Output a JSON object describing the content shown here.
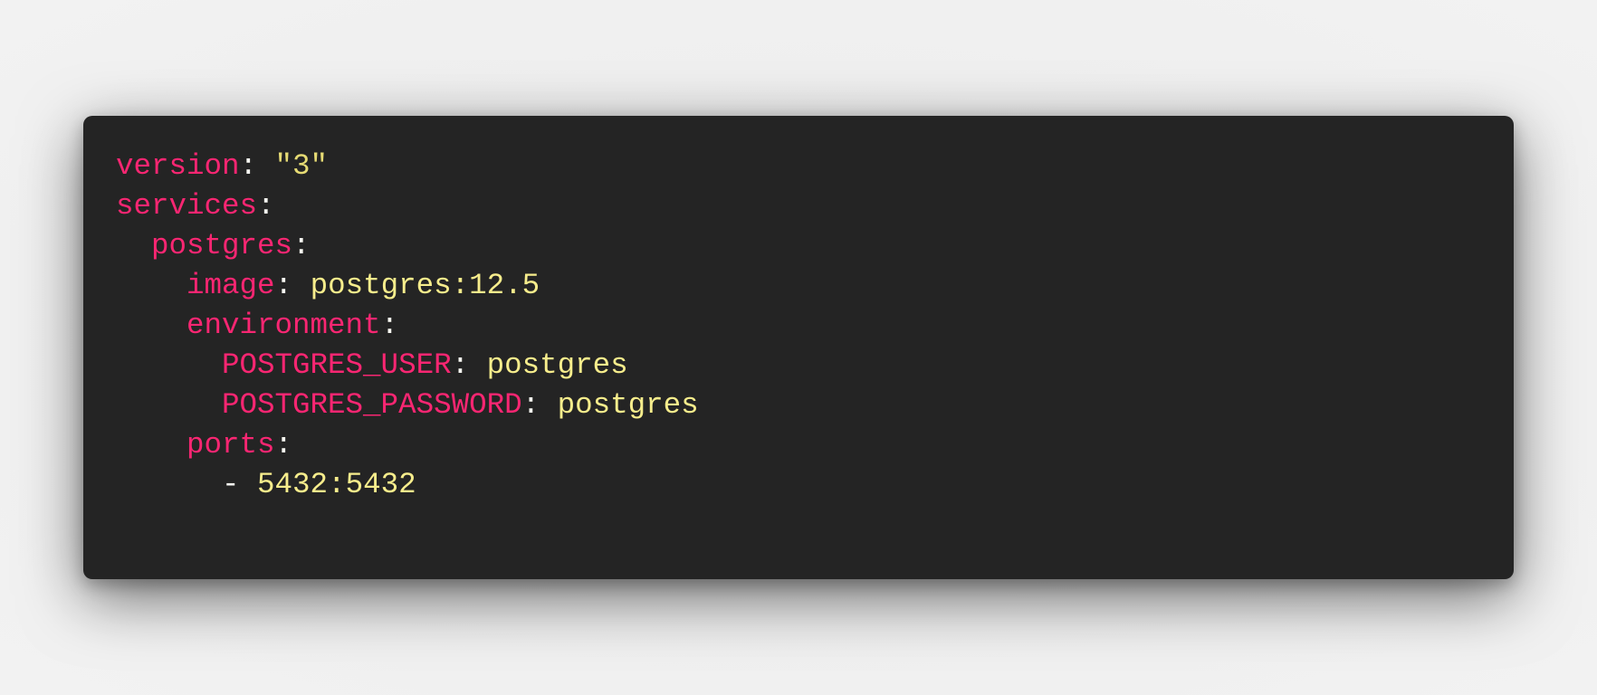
{
  "theme": {
    "key_color": "#f92672",
    "value_color": "#e6db74",
    "punct_color": "#f8f8f2",
    "background": "#242424"
  },
  "code": {
    "lines": [
      {
        "indent": "",
        "key": "version",
        "sep": ": ",
        "value": "\"3\""
      },
      {
        "indent": "",
        "key": "services",
        "sep": ":",
        "value": ""
      },
      {
        "indent": "  ",
        "key": "postgres",
        "sep": ":",
        "value": ""
      },
      {
        "indent": "    ",
        "key": "image",
        "sep": ": ",
        "value": "postgres:12.5"
      },
      {
        "indent": "    ",
        "key": "environment",
        "sep": ":",
        "value": ""
      },
      {
        "indent": "      ",
        "key": "POSTGRES_USER",
        "sep": ": ",
        "value": "postgres"
      },
      {
        "indent": "      ",
        "key": "POSTGRES_PASSWORD",
        "sep": ": ",
        "value": "postgres"
      },
      {
        "indent": "    ",
        "key": "ports",
        "sep": ":",
        "value": ""
      },
      {
        "indent": "      ",
        "key": "",
        "sep": "- ",
        "value": "5432:5432"
      }
    ]
  }
}
